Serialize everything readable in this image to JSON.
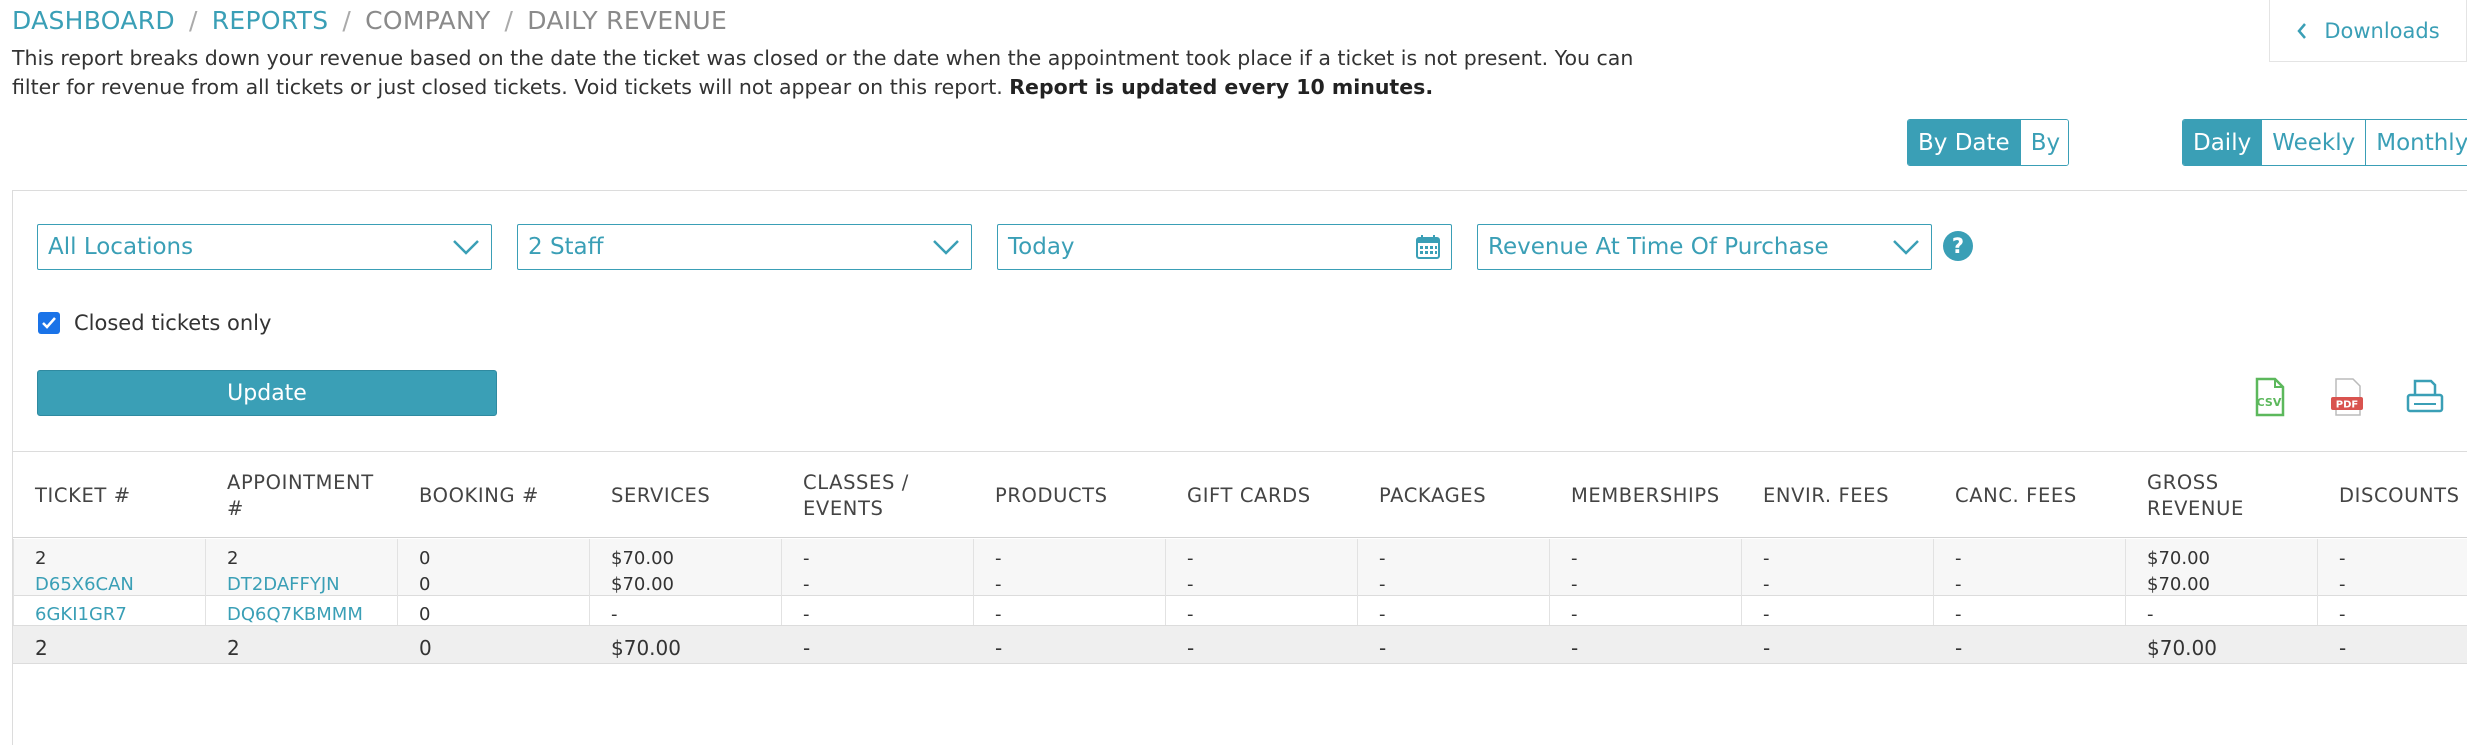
{
  "breadcrumb": {
    "dashboard": "DASHBOARD",
    "reports": "REPORTS",
    "company": "COMPANY",
    "current": "DAILY REVENUE",
    "separator": "/"
  },
  "description": {
    "text": "This report breaks down your revenue based on the date the ticket was closed or the date when the appointment took place if a ticket is not present. You can filter for revenue from all tickets or just closed tickets. Void tickets will not appear on this report. ",
    "bold": "Report is updated every 10 minutes."
  },
  "downloads": {
    "label": "Downloads",
    "icon": "chevron-left-icon"
  },
  "view_toggle": {
    "by_date": "By Date",
    "by_location": "By Location",
    "active": "By Date"
  },
  "period_toggle": {
    "daily": "Daily",
    "weekly": "Weekly",
    "monthly": "Monthly",
    "active": "Daily"
  },
  "filters": {
    "location": "All Locations",
    "staff": "2 Staff",
    "date": "Today",
    "revenue_type": "Revenue At Time Of Purchase",
    "help": "?"
  },
  "closed_only": {
    "label": "Closed tickets only",
    "checked": true
  },
  "update_button": "Update",
  "export": {
    "csv": "CSV",
    "pdf": "PDF",
    "print": "print-icon"
  },
  "colors": {
    "accent": "#3a9fb6",
    "csv_green": "#5cb85c",
    "pdf_red": "#d9534f"
  },
  "table": {
    "headers": [
      {
        "line1": "TICKET #"
      },
      {
        "line1": "APPOINTMENT #"
      },
      {
        "line1": "BOOKING #"
      },
      {
        "line1": "SERVICES"
      },
      {
        "line1": "CLASSES /",
        "line2": "EVENTS"
      },
      {
        "line1": "PRODUCTS"
      },
      {
        "line1": "GIFT CARDS"
      },
      {
        "line1": "PACKAGES"
      },
      {
        "line1": "MEMBERSHIPS"
      },
      {
        "line1": "ENVIR. FEES"
      },
      {
        "line1": "CANC. FEES"
      },
      {
        "line1": "GROSS",
        "line2": "REVENUE"
      },
      {
        "line1": "DISCOUNTS"
      }
    ],
    "group1": {
      "summary": [
        "2",
        "2",
        "0",
        "$70.00",
        "-",
        "-",
        "-",
        "-",
        "-",
        "-",
        "-",
        "$70.00",
        "-"
      ],
      "detail": [
        "D65X6CAN",
        "DT2DAFFYJN",
        "0",
        "$70.00",
        "-",
        "-",
        "-",
        "-",
        "-",
        "-",
        "-",
        "$70.00",
        "-"
      ]
    },
    "group2": [
      "6GKI1GR7",
      "DQ6Q7KBMMM",
      "0",
      "-",
      "-",
      "-",
      "-",
      "-",
      "-",
      "-",
      "-",
      "-",
      "-"
    ],
    "totals": [
      "2",
      "2",
      "0",
      "$70.00",
      "-",
      "-",
      "-",
      "-",
      "-",
      "-",
      "-",
      "$70.00",
      "-"
    ]
  }
}
